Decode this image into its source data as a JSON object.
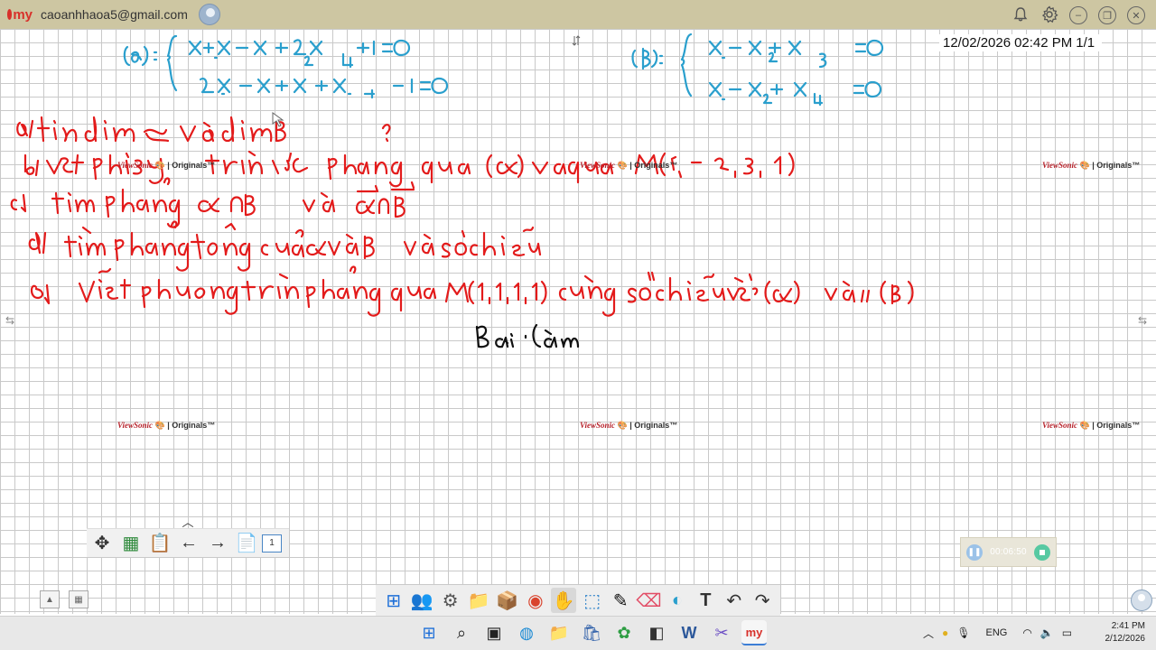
{
  "app": {
    "account_email": "caoanhhaoa5@gmail.com",
    "logo_text": "my"
  },
  "board": {
    "date": "12/02/2026",
    "time": "02:42 PM",
    "page_indicator": "1/1",
    "pen_colors": {
      "blue": "#2a9fcd",
      "red": "#e31b1b",
      "black": "#111111"
    }
  },
  "watermark": {
    "brand": "ViewSonic",
    "label": "Originals"
  },
  "left_toolbar": {
    "page_number": "1"
  },
  "recorder": {
    "elapsed": "00:06:50"
  },
  "taskbar": {
    "language": "ENG",
    "clock_time": "2:41 PM",
    "clock_date": "2/12/2026"
  },
  "icons": [
    "move-icon",
    "presenter-icon",
    "clipboard-icon",
    "back-arrow-icon",
    "forward-arrow-icon",
    "add-page-icon",
    "bell-icon",
    "gear-icon",
    "minimize-icon",
    "restore-icon",
    "close-icon",
    "windows-start-icon",
    "search-icon",
    "file-explorer-icon",
    "word-icon",
    "edge-icon"
  ]
}
